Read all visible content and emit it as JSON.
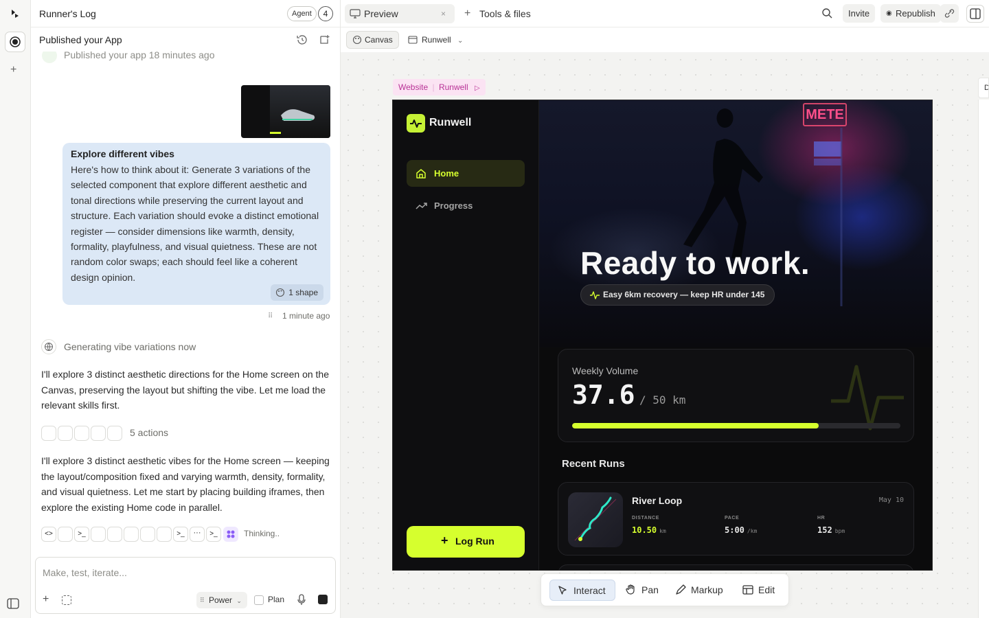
{
  "chat": {
    "project_title": "Runner's Log",
    "agent_label": "Agent",
    "agent_count": "4",
    "sub_title": "Published your App",
    "published_line": "Published your app 18 minutes ago",
    "user_message": {
      "title": "Explore different vibes",
      "body": "Here's how to think about it: Generate 3 variations of the selected component that explore different aesthetic and tonal directions while preserving the current layout and structure. Each variation should evoke a distinct emotional register — consider dimensions like warmth, density, formality, playfulness, and visual quietness. These are not random color swaps; each should feel like a coherent design opinion.",
      "shape_chip": "1 shape",
      "timestamp": "1 minute ago"
    },
    "generating": "Generating vibe variations now",
    "reply1": "I'll explore 3 distinct aesthetic directions for the Home screen on the Canvas, preserving the layout but shifting the vibe. Let me load the relevant skills first.",
    "actions_label": "5 actions",
    "reply2": "I'll explore 3 distinct aesthetic vibes for the Home screen — keeping the layout/composition fixed and varying warmth, density, formality, and visual quietness. Let me start by placing building iframes, then explore the existing Home code in parallel.",
    "thinking": "Thinking..",
    "composer": {
      "placeholder": "Make, test, iterate...",
      "mode": "Power",
      "plan": "Plan"
    }
  },
  "topbar": {
    "preview_tab": "Preview",
    "tools_tab": "Tools & files",
    "invite": "Invite",
    "republish": "Republish"
  },
  "toolbar": {
    "canvas": "Canvas",
    "runwell": "Runwell"
  },
  "canvas": {
    "frame_tag": "Website",
    "frame_name": "Runwell",
    "right_edge_letter": "D"
  },
  "app": {
    "brand": "Runwell",
    "nav": [
      "Home",
      "Progress"
    ],
    "log_run": "Log Run",
    "hero_title": "Ready to work.",
    "hero_pill": "Easy 6km recovery — keep HR under 145",
    "neon_sign": "METE",
    "weekly": {
      "label": "Weekly Volume",
      "value": "37.6",
      "target": "/ 50 km",
      "progress": 0.75
    },
    "recent_title": "Recent Runs",
    "run": {
      "name": "River Loop",
      "date": "May 10",
      "stats": [
        {
          "label": "DISTANCE",
          "value": "10.50",
          "unit": "km",
          "color": "#d6ff2e"
        },
        {
          "label": "PACE",
          "value": "5:00",
          "unit": "/km",
          "color": "#e8e8e8"
        },
        {
          "label": "HR",
          "value": "152",
          "unit": "bpm",
          "color": "#e8e8e8"
        }
      ]
    },
    "accent": "#d6ff2e"
  },
  "bottom_tools": [
    "Interact",
    "Pan",
    "Markup",
    "Edit"
  ]
}
